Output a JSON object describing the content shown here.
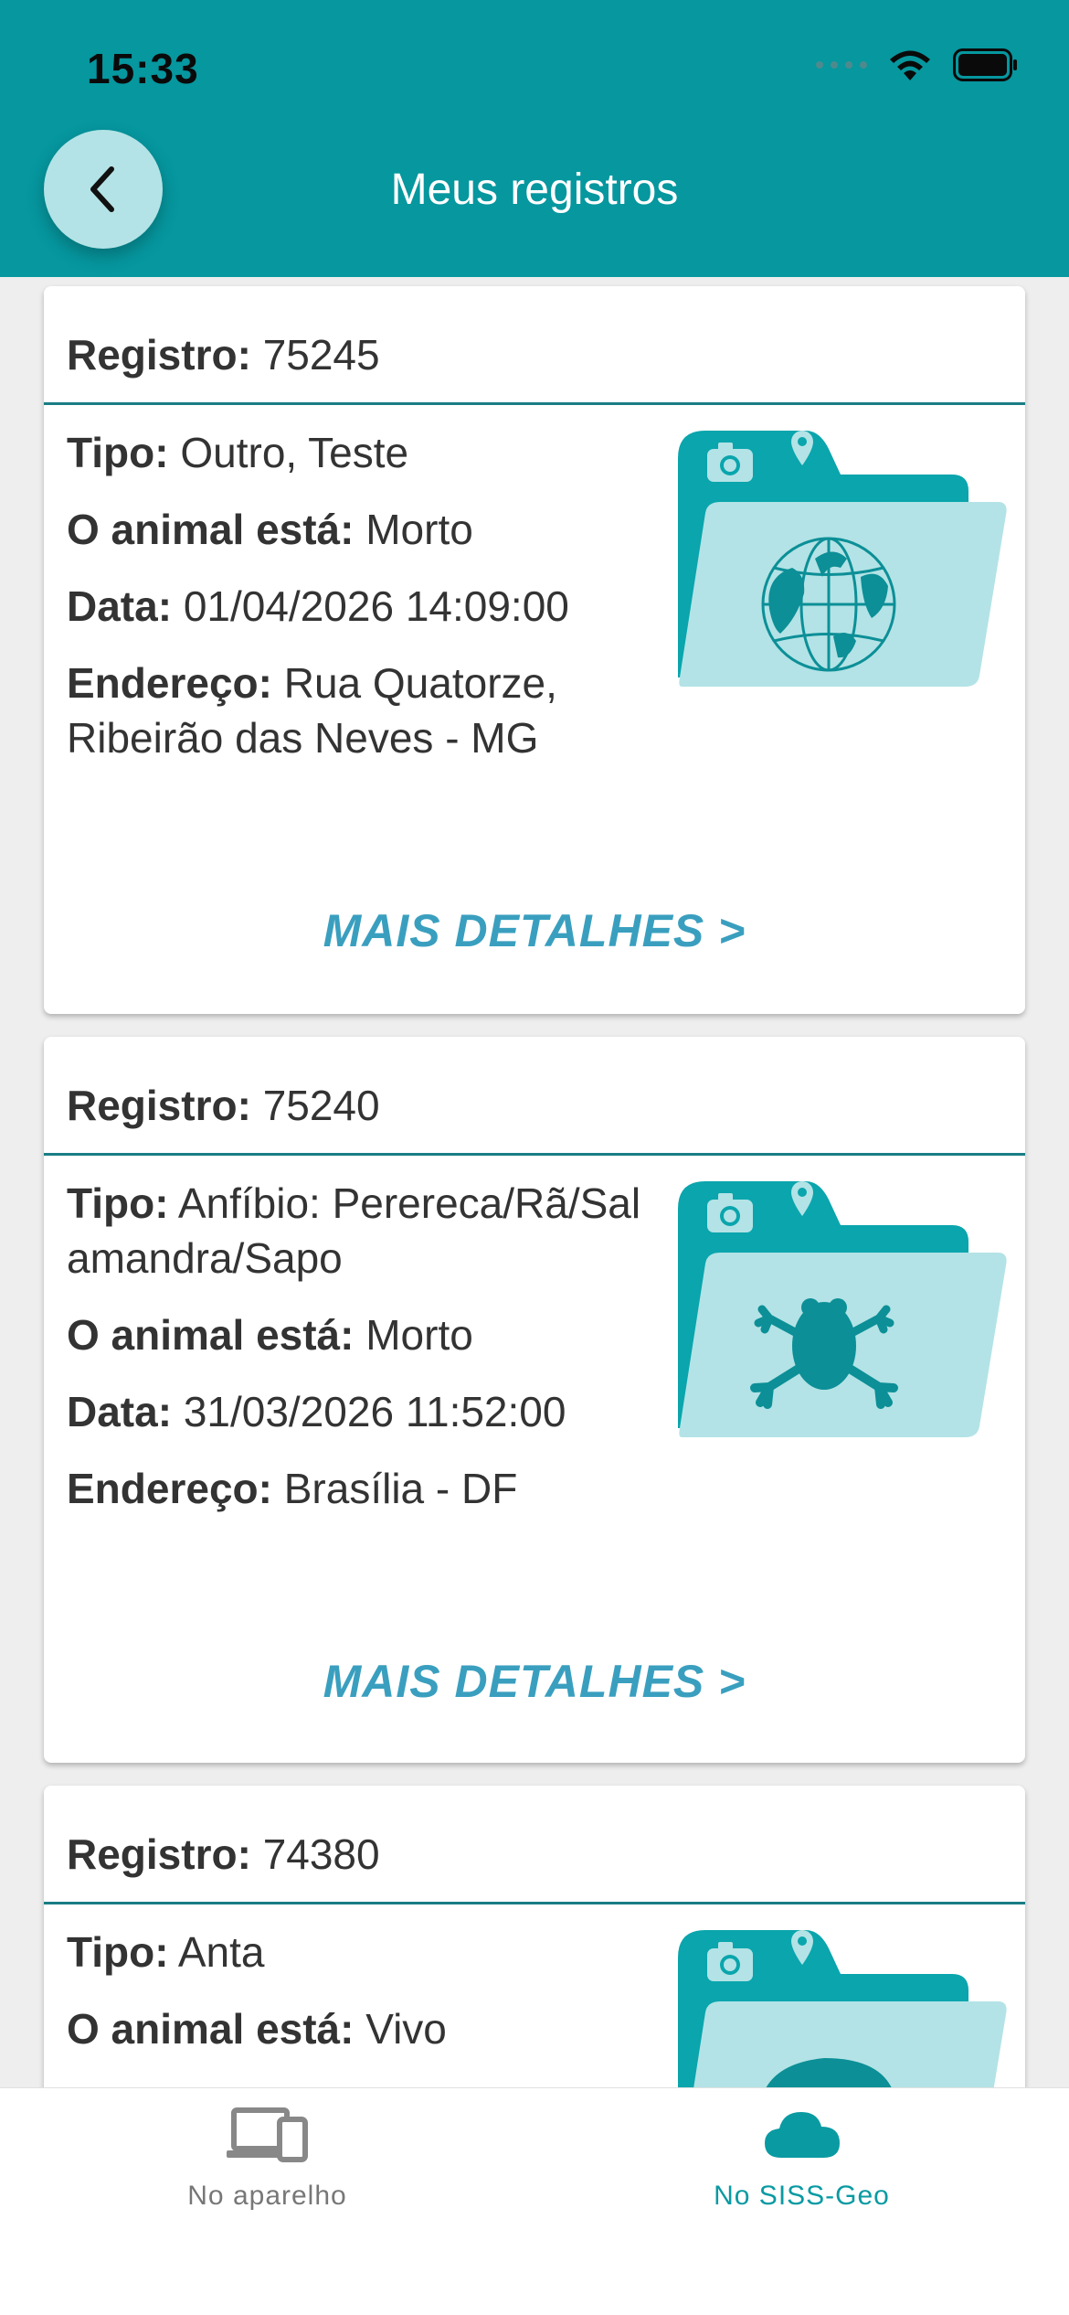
{
  "status": {
    "time": "15:33"
  },
  "header": {
    "title": "Meus registros"
  },
  "records": [
    {
      "id_label": "Registro:",
      "id": "75245",
      "tipo_label": "Tipo:",
      "tipo": "Outro, Teste",
      "estado_label": "O animal está:",
      "estado": "Morto",
      "data_label": "Data:",
      "data": "01/04/2026 14:09:00",
      "endereco_label": "Endereço:",
      "endereco": "Rua Quatorze, Ribeirão das Neves - MG",
      "icon": "globe-animals-icon",
      "more": "MAIS DETALHES >"
    },
    {
      "id_label": "Registro:",
      "id": "75240",
      "tipo_label": "Tipo:",
      "tipo": "Anfíbio: Perereca/Rã/Salamandra/Sapo",
      "estado_label": "O animal está:",
      "estado": "Morto",
      "data_label": "Data:",
      "data": "31/03/2026 11:52:00",
      "endereco_label": "Endereço:",
      "endereco": "Brasília - DF",
      "icon": "frog-icon",
      "more": "MAIS DETALHES >"
    },
    {
      "id_label": "Registro:",
      "id": "74380",
      "tipo_label": "Tipo:",
      "tipo": "Anta",
      "estado_label": "O animal está:",
      "estado": "Vivo",
      "icon": "tapir-icon"
    }
  ],
  "tabs": [
    {
      "label": "No aparelho",
      "icon": "devices-icon",
      "active": false
    },
    {
      "label": "No SISS-Geo",
      "icon": "cloud-icon",
      "active": true
    }
  ],
  "colors": {
    "primary": "#06979f",
    "accent": "#3a9fbf",
    "folder_back": "#0aa5ad",
    "folder_front": "#b3e3e6"
  }
}
